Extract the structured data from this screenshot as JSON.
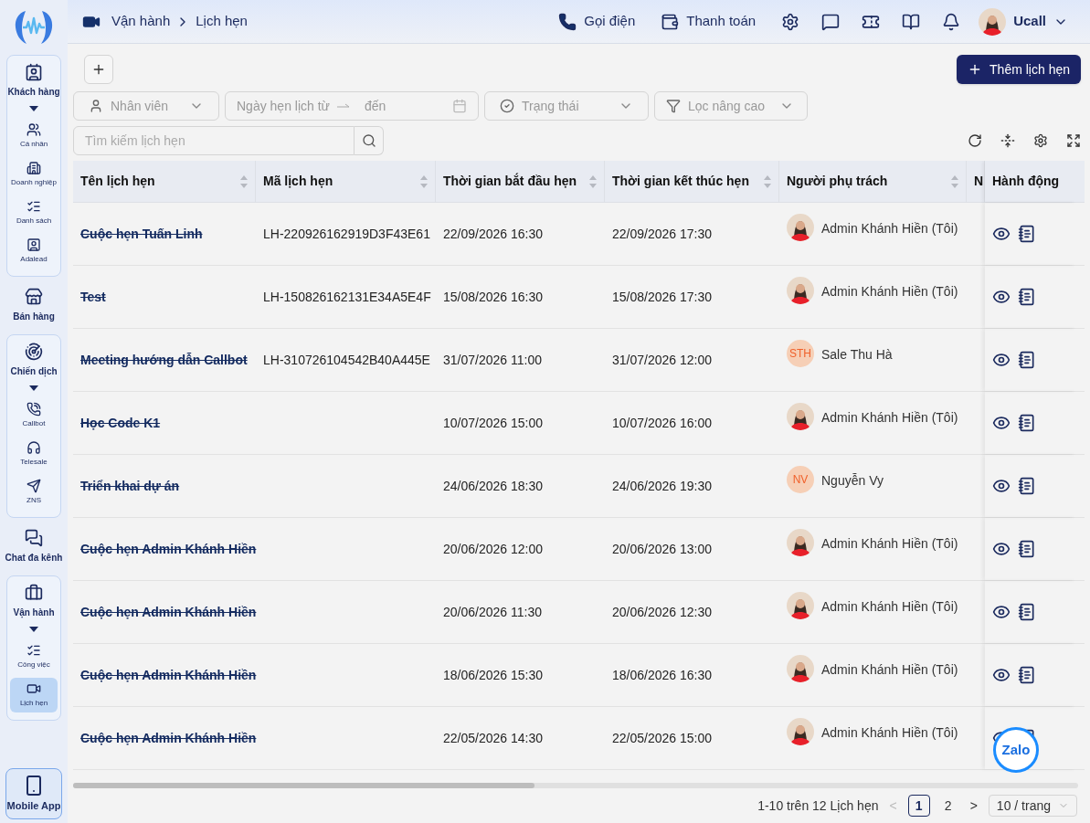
{
  "sidebar": {
    "groups": [
      {
        "kind": "group",
        "label": "Khách hàng",
        "children": [
          {
            "label": "Cá nhân",
            "selected": false
          },
          {
            "label": "Doanh nghiệp",
            "selected": false
          },
          {
            "label": "Danh sách",
            "selected": false
          },
          {
            "label": "Adalead",
            "selected": false
          }
        ]
      },
      {
        "kind": "single",
        "label": "Bán hàng"
      },
      {
        "kind": "group",
        "label": "Chiến dịch",
        "children": [
          {
            "label": "Callbot",
            "selected": false
          },
          {
            "label": "Telesale",
            "selected": false
          },
          {
            "label": "ZNS",
            "selected": false
          }
        ]
      },
      {
        "kind": "single",
        "label": "Chat đa kênh"
      },
      {
        "kind": "group",
        "label": "Vận hành",
        "children": [
          {
            "label": "Công việc",
            "selected": false
          },
          {
            "label": "Lịch hẹn",
            "selected": true
          }
        ]
      }
    ],
    "mobile_app": "Mobile App"
  },
  "breadcrumb": [
    "Vận hành",
    "Lịch hẹn"
  ],
  "topbar": {
    "call": "Gọi điện",
    "payment": "Thanh toán",
    "user": "Ucall"
  },
  "add_button": "Thêm lịch hẹn",
  "filters": {
    "staff": "Nhân viên",
    "date_from": "Ngày hẹn lịch từ",
    "date_to": "đến",
    "status": "Trạng thái",
    "advanced": "Lọc nâng cao"
  },
  "search": {
    "placeholder": "Tìm kiếm lịch hẹn"
  },
  "table": {
    "columns": [
      "Tên lịch hẹn",
      "Mã lịch hẹn",
      "Thời gian bắt đầu hẹn",
      "Thời gian kết thúc hẹn",
      "Người phụ trách",
      "N"
    ],
    "action_column": "Hành động",
    "rows": [
      {
        "name": "Cuộc hẹn Tuấn Linh",
        "struck": true,
        "code": "LH-220926162919D3F43E61",
        "start": "22/09/2026 16:30",
        "end": "22/09/2026 17:30",
        "owner": {
          "name": "Admin Khánh Hiền (Tôi)"
        }
      },
      {
        "name": "Test",
        "struck": true,
        "code": "LH-150826162131E34A5E4F",
        "start": "15/08/2026 16:30",
        "end": "15/08/2026 17:30",
        "owner": {
          "name": "Admin Khánh Hiền (Tôi)"
        }
      },
      {
        "name": "Meeting hướng dẫn Callbot",
        "struck": true,
        "code": "LH-310726104542B40A445E",
        "start": "31/07/2026 11:00",
        "end": "31/07/2026 12:00",
        "owner": {
          "kind": "initials",
          "initials": "STH",
          "name": "Sale Thu Hà"
        }
      },
      {
        "name": "Học Code K1",
        "struck": true,
        "start": "10/07/2026 15:00",
        "end": "10/07/2026 16:00",
        "owner": {
          "name": "Admin Khánh Hiền (Tôi)"
        }
      },
      {
        "name": "Triển khai dự án",
        "struck": true,
        "start": "24/06/2026 18:30",
        "end": "24/06/2026 19:30",
        "owner": {
          "kind": "initials",
          "initials": "NV",
          "name": "Nguyễn Vy"
        }
      },
      {
        "name": "Cuộc hẹn Admin Khánh Hiền",
        "struck": true,
        "start": "20/06/2026 12:00",
        "end": "20/06/2026 13:00",
        "owner": {
          "name": "Admin Khánh Hiền (Tôi)"
        }
      },
      {
        "name": "Cuộc hẹn Admin Khánh Hiền",
        "struck": true,
        "start": "20/06/2026 11:30",
        "end": "20/06/2026 12:30",
        "owner": {
          "name": "Admin Khánh Hiền (Tôi)"
        }
      },
      {
        "name": "Cuộc hẹn Admin Khánh Hiền",
        "struck": true,
        "start": "18/06/2026 15:30",
        "end": "18/06/2026 16:30",
        "owner": {
          "name": "Admin Khánh Hiền (Tôi)"
        }
      },
      {
        "name": "Cuộc hẹn Admin Khánh Hiền",
        "struck": true,
        "start": "22/05/2026 14:30",
        "end": "22/05/2026 15:00",
        "owner": {
          "name": "Admin Khánh Hiền (Tôi)"
        }
      }
    ]
  },
  "pagination": {
    "summary": "1-10 trên 12 Lịch hẹn",
    "prev": "<",
    "next": ">",
    "pages": [
      {
        "label": "1",
        "selected": true
      },
      {
        "label": "2",
        "selected": false
      }
    ],
    "page_size": "10 / trang"
  },
  "zalo": "Zalo"
}
